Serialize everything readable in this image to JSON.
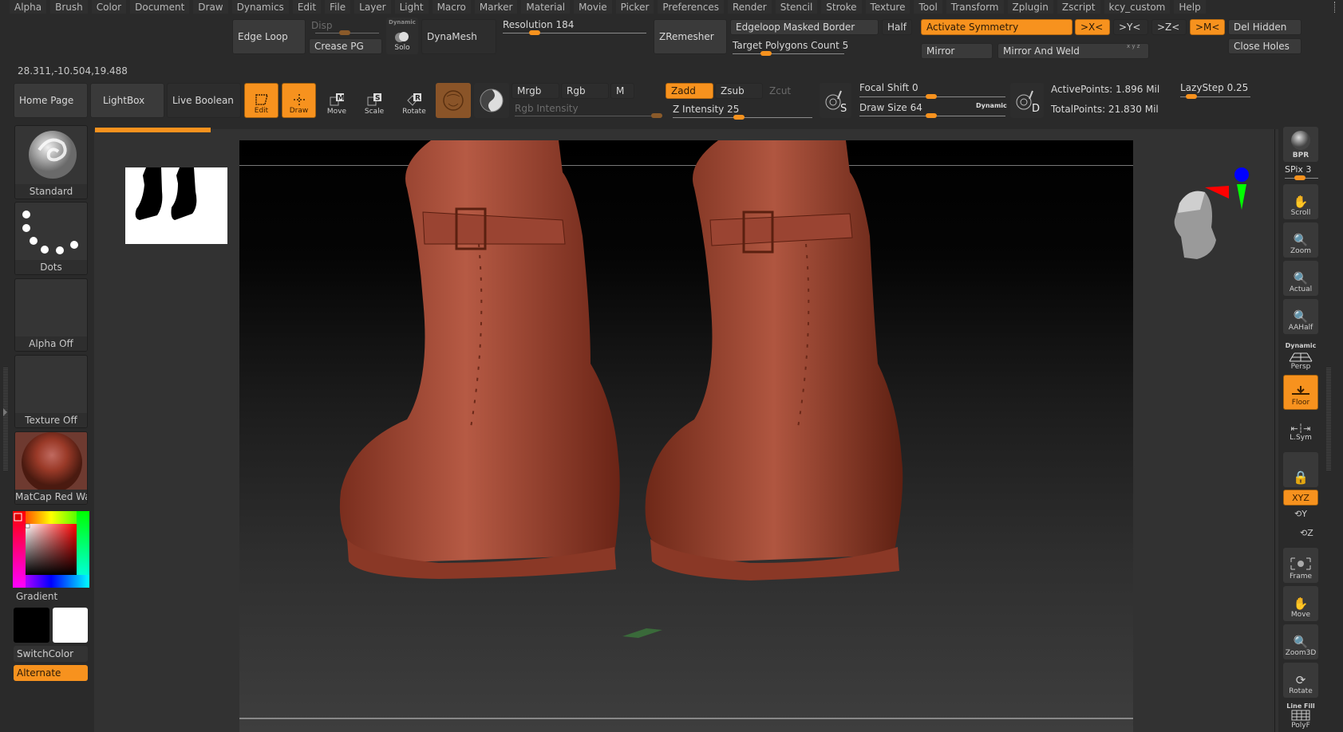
{
  "menu": [
    "Alpha",
    "Brush",
    "Color",
    "Document",
    "Draw",
    "Dynamics",
    "Edit",
    "File",
    "Layer",
    "Light",
    "Macro",
    "Marker",
    "Material",
    "Movie",
    "Picker",
    "Preferences",
    "Render",
    "Stencil",
    "Stroke",
    "Texture",
    "Tool",
    "Transform",
    "Zplugin",
    "Zscript",
    "kcy_custom",
    "Help"
  ],
  "coords": "28.311,-10.504,19.488",
  "toptools": {
    "edge_loop": "Edge Loop",
    "disp": "Disp",
    "crease_pg": "Crease PG",
    "dynamic_small": "Dynamic",
    "solo": "Solo",
    "dynamesh": "DynaMesh",
    "resolution_label": "Resolution 184",
    "resolution_value": 184,
    "zremesher": "ZRemesher",
    "edgeloop_masked_border": "Edgeloop Masked Border",
    "target_polygons": "Target Polygons Count 5",
    "half": "Half",
    "activate_symmetry": "Activate Symmetry",
    "sym_x": ">X<",
    "sym_y": ">Y<",
    "sym_z": ">Z<",
    "sym_m": ">M<",
    "mirror": "Mirror",
    "mirror_and_weld": "Mirror And Weld",
    "xyz_mini": "x y z",
    "del_hidden": "Del Hidden",
    "close_holes": "Close Holes"
  },
  "toolbar": {
    "home_page": "Home Page",
    "lightbox": "LightBox",
    "live_boolean": "Live Boolean",
    "edit": "Edit",
    "draw": "Draw",
    "move": "Move",
    "scale": "Scale",
    "rotate": "Rotate",
    "mrgb": "Mrgb",
    "rgb": "Rgb",
    "m": "M",
    "rgb_intensity": "Rgb Intensity",
    "zadd": "Zadd",
    "zsub": "Zsub",
    "zcut": "Zcut",
    "z_intensity": "Z Intensity 25",
    "focal_shift": "Focal Shift 0",
    "draw_size": "Draw Size 64",
    "dynamic": "Dynamic",
    "active_points": "ActivePoints: 1.896 Mil",
    "total_points": "TotalPoints: 21.830 Mil",
    "lazystep": "LazyStep 0.25",
    "s_badge": "S",
    "d_badge": "D"
  },
  "left": {
    "brush": "Standard",
    "stroke": "Dots",
    "alpha": "Alpha Off",
    "texture": "Texture Off",
    "material": "MatCap Red Wax",
    "gradient": "Gradient",
    "switchcolor": "SwitchColor",
    "alternate": "Alternate"
  },
  "right": {
    "bpr": "BPR",
    "spix": "SPix 3",
    "scroll": "Scroll",
    "zoom": "Zoom",
    "actual": "Actual",
    "aahalf": "AAHalf",
    "dynamic": "Dynamic",
    "persp": "Persp",
    "floor": "Floor",
    "lsym": "L.Sym",
    "xyz": "XYZ",
    "frame": "Frame",
    "move": "Move",
    "zoom3d": "Zoom3D",
    "rotate": "Rotate",
    "line_fill": "Line Fill",
    "polyf": "PolyF"
  },
  "colors": {
    "accent": "#f7921e",
    "panel": "#2a2a2a",
    "button": "#3a3a3a",
    "clay": "#a84a34"
  }
}
